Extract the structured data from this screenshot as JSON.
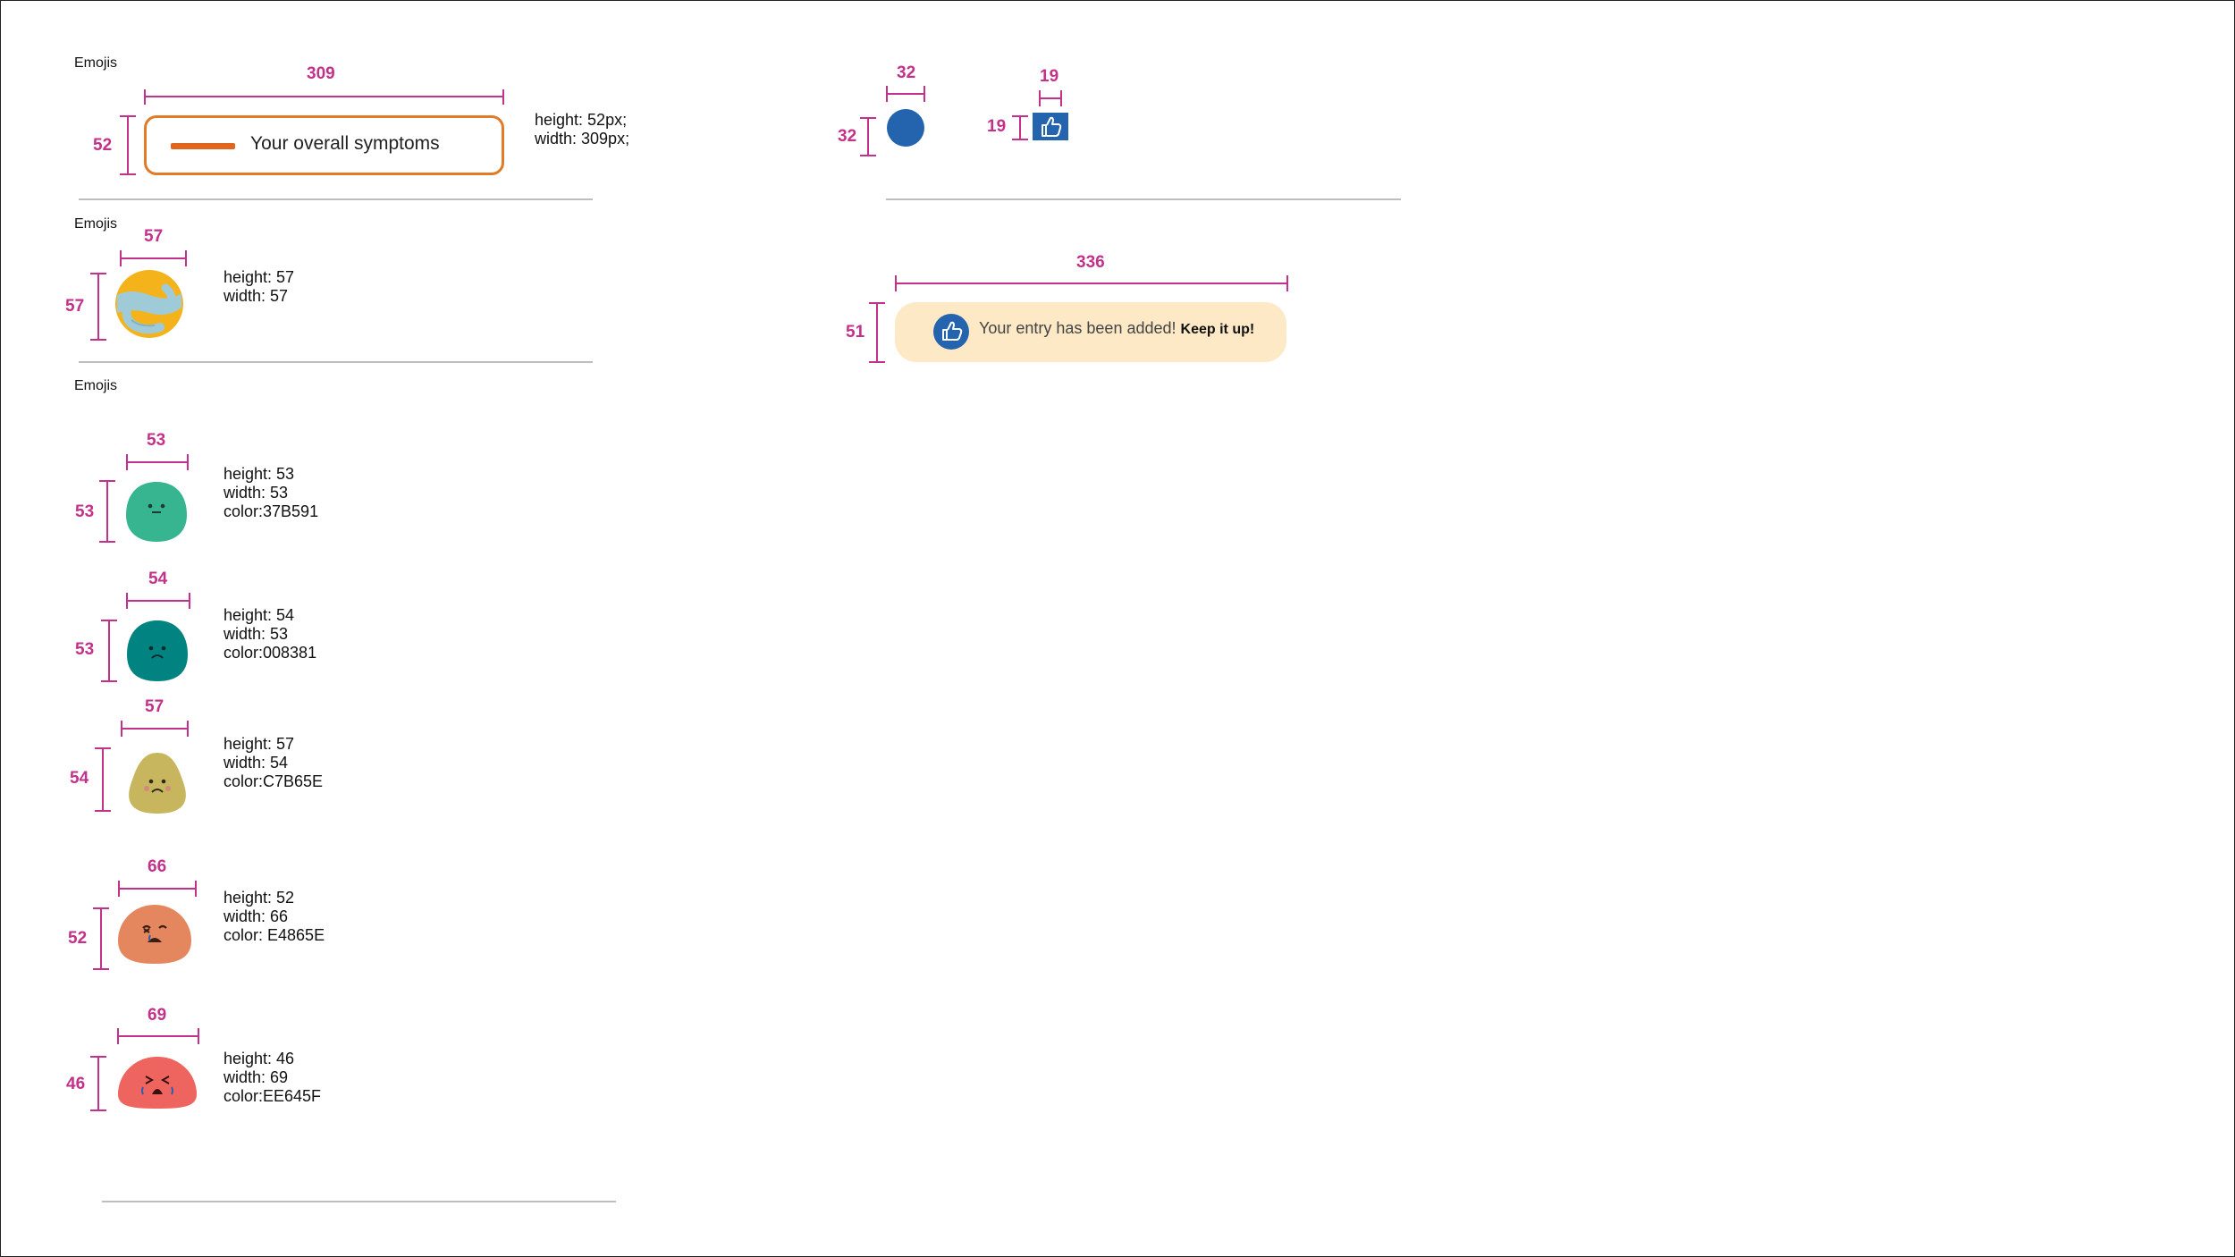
{
  "sections": {
    "s1_title": "Emojis",
    "s2_title": "Emojis",
    "s3_title": "Emojis"
  },
  "symptom_pill": {
    "label": "Your overall symptoms",
    "dim_w": "309",
    "dim_h": "52",
    "spec": "height: 52px;\nwidth: 309px;",
    "border_color": "#E07B2A",
    "bar_color": "#E0661E"
  },
  "hug_emoji": {
    "dim_w": "57",
    "dim_h": "57",
    "spec": "height: 57\nwidth: 57",
    "icon": "hugging-globe-icon"
  },
  "moods": [
    {
      "icon": "neutral-face-icon",
      "dim_w": "53",
      "dim_h": "53",
      "spec": "height: 53\nwidth: 53\ncolor:37B591",
      "color": "#37B591"
    },
    {
      "icon": "sad-face-icon",
      "dim_w": "54",
      "dim_h": "53",
      "spec": "height: 54\nwidth: 53\ncolor:008381",
      "color": "#008381"
    },
    {
      "icon": "sick-face-icon",
      "dim_w": "57",
      "dim_h": "54",
      "spec": "height: 57\nwidth: 54\ncolor:C7B65E",
      "color": "#C7B65E"
    },
    {
      "icon": "distressed-face-icon",
      "dim_w": "66",
      "dim_h": "52",
      "spec": "height: 52\nwidth: 66\ncolor: E4865E",
      "color": "#E4865E"
    },
    {
      "icon": "crying-face-icon",
      "dim_w": "69",
      "dim_h": "46",
      "spec": "height: 46\nwidth: 69\ncolor:EE645F",
      "color": "#EE645F"
    }
  ],
  "circle": {
    "dim_w": "32",
    "dim_h": "32",
    "color": "#2463AE"
  },
  "thumb_square": {
    "dim_w": "19",
    "dim_h": "19",
    "color": "#2463AE",
    "icon": "thumbs-up-icon"
  },
  "toast": {
    "dim_w": "336",
    "dim_h": "51",
    "message": "Your entry has been added!",
    "emphasis": "Keep it up!",
    "background": "#FDE9C6",
    "icon": "thumbs-up-icon"
  },
  "colors": {
    "dimension": "#C2328A",
    "divider": "#BDBDBD"
  }
}
